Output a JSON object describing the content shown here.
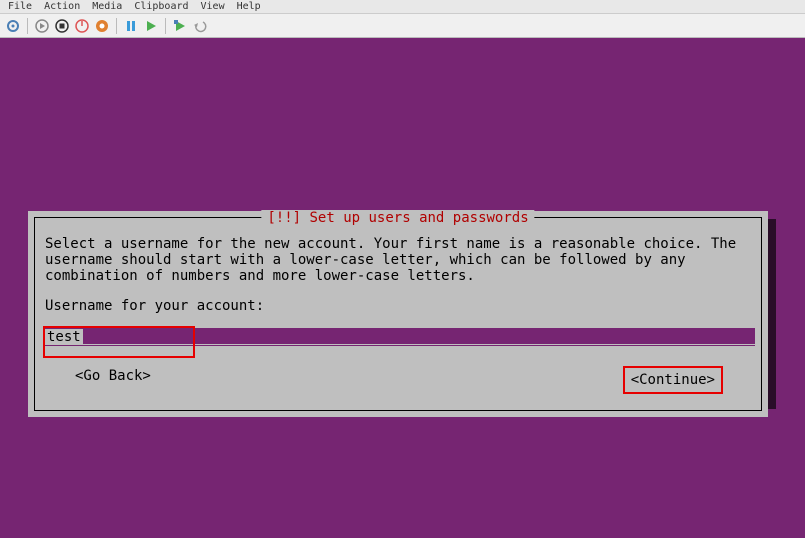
{
  "menubar": {
    "items": [
      "File",
      "Action",
      "Media",
      "Clipboard",
      "View",
      "Help"
    ]
  },
  "toolbar": {
    "icons": [
      "gear-icon",
      "start-icon",
      "stop-icon",
      "shutdown-icon",
      "power-icon",
      "pause-icon",
      "play-icon",
      "snapshot-icon",
      "undo-icon"
    ]
  },
  "dialog": {
    "title_prefix": "[!!] ",
    "title": "Set up users and passwords",
    "body": "Select a username for the new account. Your first name is a reasonable choice. The username should start with a lower-case letter, which can be followed by any combination of numbers and more lower-case letters.",
    "prompt": "Username for your account:",
    "input_value": "test",
    "go_back_label": "<Go Back>",
    "continue_label": "<Continue>"
  },
  "colors": {
    "installer_bg": "#762572",
    "dialog_bg": "#bfbfbf",
    "title_red": "#b00000",
    "highlight": "#e60000"
  }
}
